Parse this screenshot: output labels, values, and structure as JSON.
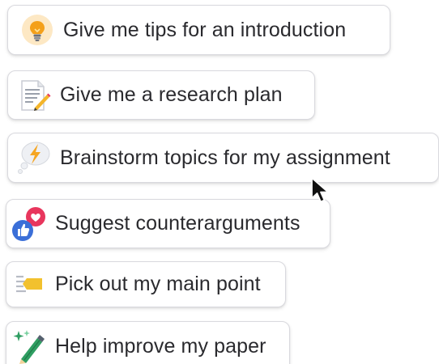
{
  "prompts": [
    {
      "label": "Give me tips for an introduction",
      "icon": "lightbulb-icon"
    },
    {
      "label": "Give me a research plan",
      "icon": "memo-pencil-icon"
    },
    {
      "label": "Brainstorm topics for my assignment",
      "icon": "thought-bubble-lightning-icon"
    },
    {
      "label": "Suggest counterarguments",
      "icon": "heart-thumbs-up-icon"
    },
    {
      "label": "Pick out my main point",
      "icon": "highlight-arrow-icon"
    },
    {
      "label": "Help improve my paper",
      "icon": "sparkle-pencil-icon"
    }
  ],
  "colors": {
    "text": "#2a2a2e",
    "chip_border": "#d9d9de",
    "bulb_bg": "#fde8c4",
    "bulb": "#f4a01a",
    "lightning": "#f5a623",
    "heart": "#e8365d",
    "thumb": "#3b6fd8",
    "highlight": "#f2c12e",
    "pencil": "#2f9e62"
  }
}
